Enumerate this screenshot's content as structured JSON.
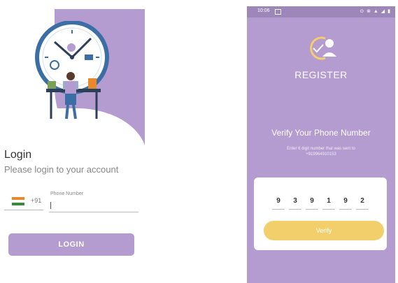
{
  "login": {
    "title": "Login",
    "subtitle": "Please login to your account",
    "country_code": "+91",
    "phone_label": "Phone Number",
    "button": "LOGIN"
  },
  "register": {
    "status_time": "10:06",
    "status_icons": "⊙ ⊗ ▲ ◢ ▮",
    "title": "REGISTER",
    "verify_title": "Verify Your Phone Number",
    "verify_sub": "Enter 6 digit number that was sent to +919964910153",
    "otp": [
      "9",
      "3",
      "9",
      "1",
      "9",
      "2"
    ],
    "button": "Verify"
  },
  "colors": {
    "purple": "#b49bd0",
    "yellow": "#f2cf6a"
  }
}
